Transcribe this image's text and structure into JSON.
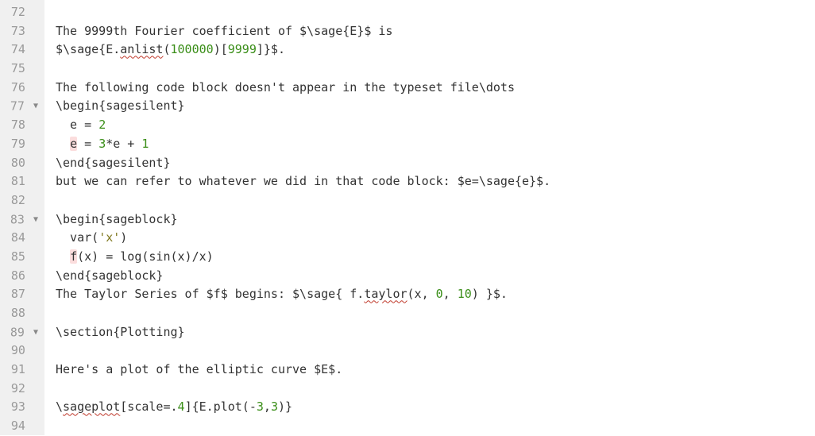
{
  "editor": {
    "first_line_number": 72,
    "lines": [
      {
        "n": 72,
        "fold": "",
        "segs": []
      },
      {
        "n": 73,
        "fold": "",
        "segs": [
          {
            "t": "The 9999th Fourier coefficient of $\\sage{E}$ is"
          }
        ]
      },
      {
        "n": 74,
        "fold": "",
        "segs": [
          {
            "t": "$\\sage{E."
          },
          {
            "t": "anlist",
            "cls": "wavy"
          },
          {
            "t": "("
          },
          {
            "t": "100000",
            "cls": "c-num"
          },
          {
            "t": ")["
          },
          {
            "t": "9999",
            "cls": "c-num"
          },
          {
            "t": "]}$."
          }
        ]
      },
      {
        "n": 75,
        "fold": "",
        "segs": []
      },
      {
        "n": 76,
        "fold": "",
        "segs": [
          {
            "t": "The following code block doesn't appear in the typeset file\\dots"
          }
        ]
      },
      {
        "n": 77,
        "fold": "▼",
        "segs": [
          {
            "t": "\\begin{sagesilent}"
          }
        ]
      },
      {
        "n": 78,
        "fold": "",
        "segs": [
          {
            "t": "  e = "
          },
          {
            "t": "2",
            "cls": "c-num"
          }
        ]
      },
      {
        "n": 79,
        "fold": "",
        "segs": [
          {
            "t": "  "
          },
          {
            "t": "e",
            "cls": "c-err"
          },
          {
            "t": " = "
          },
          {
            "t": "3",
            "cls": "c-num"
          },
          {
            "t": "*e + "
          },
          {
            "t": "1",
            "cls": "c-num"
          }
        ]
      },
      {
        "n": 80,
        "fold": "",
        "segs": [
          {
            "t": "\\end{sagesilent}"
          }
        ]
      },
      {
        "n": 81,
        "fold": "",
        "segs": [
          {
            "t": "but we can refer to whatever we did in that code block: $e=\\sage{e}$."
          }
        ]
      },
      {
        "n": 82,
        "fold": "",
        "segs": []
      },
      {
        "n": 83,
        "fold": "▼",
        "segs": [
          {
            "t": "\\begin{sageblock}"
          }
        ]
      },
      {
        "n": 84,
        "fold": "",
        "segs": [
          {
            "t": "  var("
          },
          {
            "t": "'x'",
            "cls": "c-str"
          },
          {
            "t": ")"
          }
        ]
      },
      {
        "n": 85,
        "fold": "",
        "segs": [
          {
            "t": "  "
          },
          {
            "t": "f",
            "cls": "c-err"
          },
          {
            "t": "(x) = log(sin(x)/x)"
          }
        ]
      },
      {
        "n": 86,
        "fold": "",
        "segs": [
          {
            "t": "\\end{sageblock}"
          }
        ]
      },
      {
        "n": 87,
        "fold": "",
        "segs": [
          {
            "t": "The Taylor Series of $f$ begins: $\\sage{ f."
          },
          {
            "t": "taylor",
            "cls": "wavy"
          },
          {
            "t": "(x, "
          },
          {
            "t": "0",
            "cls": "c-num"
          },
          {
            "t": ", "
          },
          {
            "t": "10",
            "cls": "c-num"
          },
          {
            "t": ") }$."
          }
        ]
      },
      {
        "n": 88,
        "fold": "",
        "segs": []
      },
      {
        "n": 89,
        "fold": "▼",
        "segs": [
          {
            "t": "\\section{Plotting}"
          }
        ]
      },
      {
        "n": 90,
        "fold": "",
        "segs": []
      },
      {
        "n": 91,
        "fold": "",
        "segs": [
          {
            "t": "Here's a plot of the elliptic curve $E$."
          }
        ]
      },
      {
        "n": 92,
        "fold": "",
        "segs": []
      },
      {
        "n": 93,
        "fold": "",
        "segs": [
          {
            "t": "\\"
          },
          {
            "t": "sageplot",
            "cls": "wavy"
          },
          {
            "t": "[scale=."
          },
          {
            "t": "4",
            "cls": "c-num"
          },
          {
            "t": "]{E.plot(-"
          },
          {
            "t": "3",
            "cls": "c-num"
          },
          {
            "t": ","
          },
          {
            "t": "3",
            "cls": "c-num"
          },
          {
            "t": ")}"
          }
        ]
      },
      {
        "n": 94,
        "fold": "",
        "segs": []
      }
    ]
  }
}
